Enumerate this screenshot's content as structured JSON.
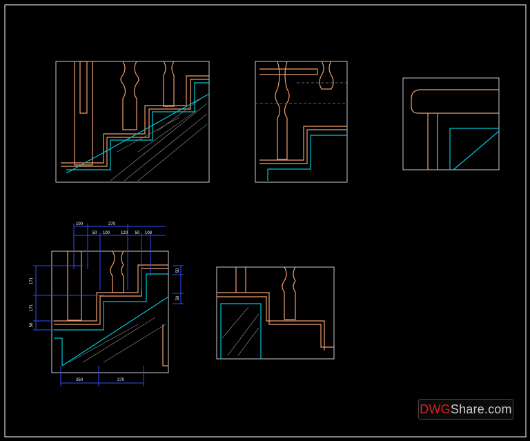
{
  "colors": {
    "background": "#000000",
    "frame": "#ffffff",
    "railing": "#f0a070",
    "section_hatch": "#00c8d8",
    "dimension": "#2f4bff",
    "dimension_text": "#ffffff",
    "dashed": "#aaaaaa",
    "watermark_red": "#d8201d",
    "watermark_gray": "#cfcfcf"
  },
  "dimensions": {
    "top_row_1": [
      "100",
      "270"
    ],
    "top_row_2": [
      "50",
      "100",
      "120",
      "50",
      "100"
    ],
    "left_column": [
      "171",
      "171",
      "50"
    ],
    "right_column": [
      "50",
      "50"
    ],
    "bottom_row": [
      "250",
      "270"
    ]
  },
  "watermark": {
    "part1": "DWG",
    "part2": "Share.com"
  }
}
